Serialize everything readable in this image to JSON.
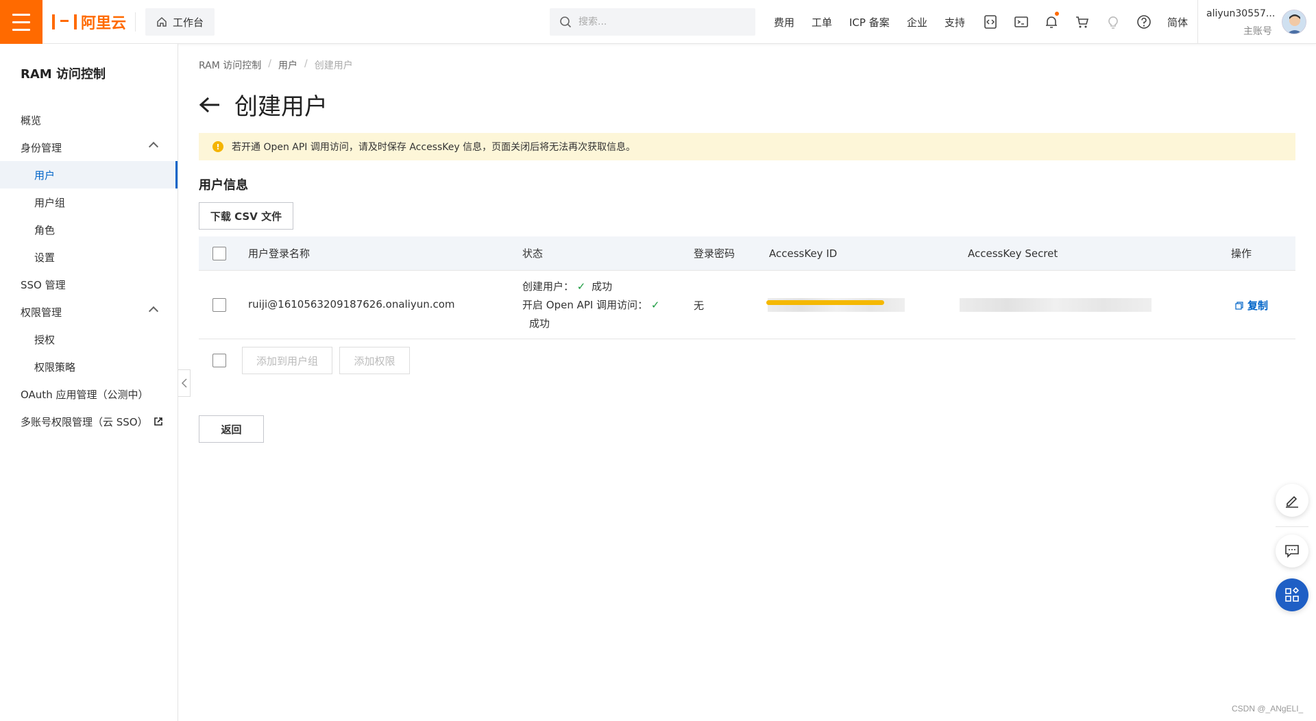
{
  "topbar": {
    "brand": "阿里云",
    "workbench": "工作台",
    "search_placeholder": "搜索...",
    "nav": [
      "费用",
      "工单",
      "ICP 备案",
      "企业",
      "支持"
    ],
    "icons": [
      "code-bracket-icon",
      "terminal-icon",
      "bell-icon",
      "cart-icon",
      "lightbulb-icon",
      "help-icon"
    ],
    "lang": "简体",
    "user_name": "aliyun30557...",
    "user_type": "主账号",
    "brand_color": "#ff6a00"
  },
  "sidebar": {
    "title": "RAM 访问控制",
    "items": [
      {
        "label": "概览"
      },
      {
        "label": "身份管理"
      },
      {
        "label": "用户"
      },
      {
        "label": "用户组"
      },
      {
        "label": "角色"
      },
      {
        "label": "设置"
      },
      {
        "label": "SSO 管理"
      },
      {
        "label": "权限管理"
      },
      {
        "label": "授权"
      },
      {
        "label": "权限策略"
      },
      {
        "label": "OAuth 应用管理（公测中）"
      },
      {
        "label": "多账号权限管理（云 SSO）"
      }
    ]
  },
  "breadcrumb": [
    "RAM 访问控制",
    "用户",
    "创建用户"
  ],
  "page": {
    "title": "创建用户",
    "alert": "若开通 Open API 调用访问，请及时保存 AccessKey 信息，页面关闭后将无法再次获取信息。",
    "section_title": "用户信息",
    "download_csv": "下载 CSV 文件",
    "add_to_group": "添加到用户组",
    "add_permission": "添加权限",
    "back": "返回"
  },
  "table": {
    "headers": [
      "用户登录名称",
      "状态",
      "登录密码",
      "AccessKey ID",
      "AccessKey Secret",
      "操作"
    ],
    "rows": [
      {
        "login_name": "ruiji@1610563209187626.onaliyun.com",
        "status_create": "创建用户：",
        "status_create_result": "成功",
        "status_api": "开启 Open API 调用访问：",
        "status_api_result": "成功",
        "password": "无",
        "action": "复制"
      }
    ]
  },
  "watermark": "CSDN @_ANgELI_"
}
